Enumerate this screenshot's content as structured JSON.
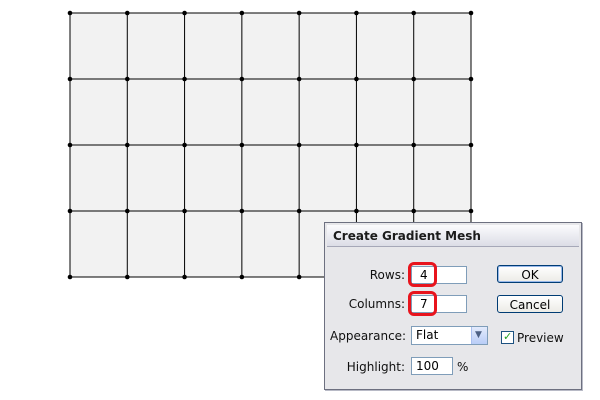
{
  "dialog": {
    "title": "Create Gradient Mesh",
    "rows_label": "Rows:",
    "rows_value": "4",
    "columns_label": "Columns:",
    "columns_value": "7",
    "appearance_label": "Appearance:",
    "appearance_value": "Flat",
    "highlight_label": "Highlight:",
    "highlight_value": "100",
    "highlight_unit": "%",
    "ok_label": "OK",
    "cancel_label": "Cancel",
    "preview_label": "Preview",
    "preview_checked": true
  },
  "mesh": {
    "rows": 4,
    "columns": 7,
    "fill_color": "#f2f2f2",
    "line_color": "#000000"
  },
  "colors": {
    "highlight_ring": "#e8141d",
    "checkmark": "#21a121"
  }
}
